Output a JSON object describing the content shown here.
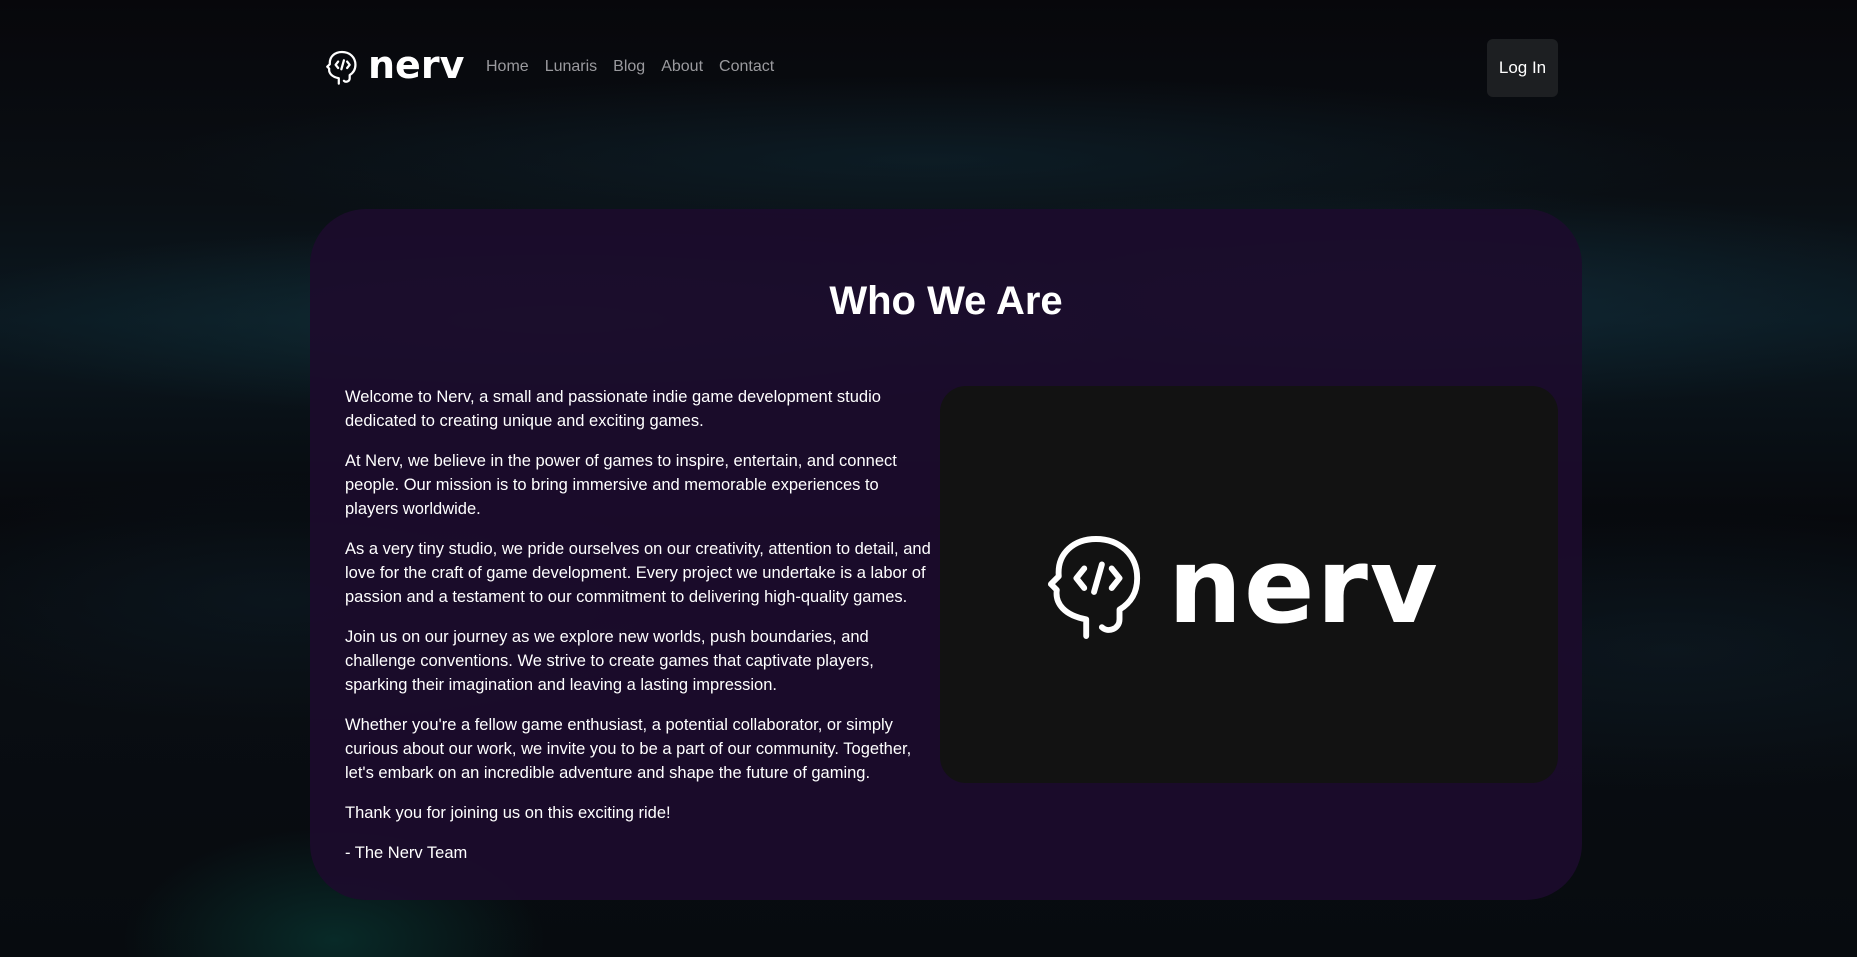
{
  "brand": {
    "name": "nerv",
    "icon": "head-code-icon"
  },
  "nav": {
    "items": [
      {
        "label": "Home"
      },
      {
        "label": "Lunaris"
      },
      {
        "label": "Blog"
      },
      {
        "label": "About"
      },
      {
        "label": "Contact"
      }
    ]
  },
  "header": {
    "login_label": "Log In"
  },
  "about": {
    "title": "Who We Are",
    "paragraphs": [
      "Welcome to Nerv, a small and passionate indie game development studio dedicated to creating unique and exciting games.",
      "At Nerv, we believe in the power of games to inspire, entertain, and connect people. Our mission is to bring immersive and memorable experiences to players worldwide.",
      "As a very tiny studio, we pride ourselves on our creativity, attention to detail, and love for the craft of game development. Every project we undertake is a labor of passion and a testament to our commitment to delivering high-quality games.",
      "Join us on our journey as we explore new worlds, push boundaries, and challenge conventions. We strive to create games that captivate players, sparking their imagination and leaving a lasting impression.",
      "Whether you're a fellow game enthusiast, a potential collaborator, or simply curious about our work, we invite you to be a part of our community. Together, let's embark on an incredible adventure and shape the future of gaming.",
      "Thank you for joining us on this exciting ride!",
      "- The Nerv Team"
    ],
    "logo": {
      "wordmark": "nerv",
      "icon": "head-code-icon"
    }
  },
  "colors": {
    "background": "#07070b",
    "card": "#1c0c2c",
    "logo_box": "#121212",
    "nav_link": "#9a9a9e",
    "button": "#1d1f22"
  }
}
